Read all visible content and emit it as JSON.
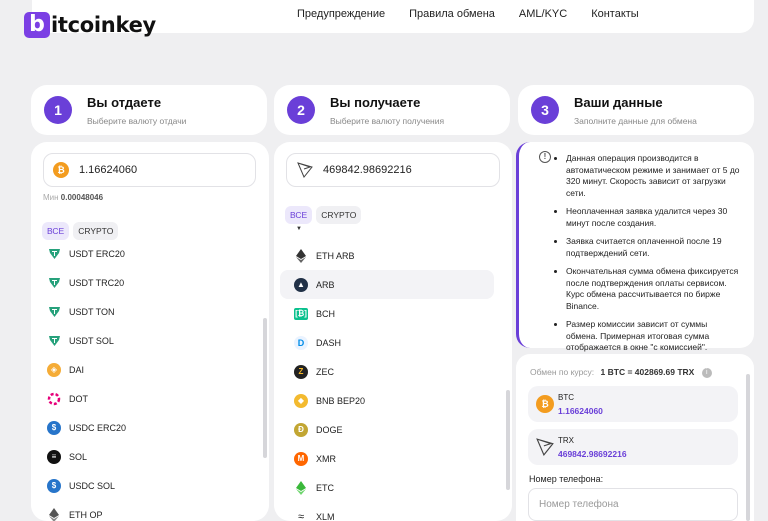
{
  "header": {
    "logo_b": "b",
    "logo_text": "itcoinkey",
    "nav": [
      "Предупреждение",
      "Правила обмена",
      "AML/KYC",
      "Контакты"
    ]
  },
  "steps": [
    {
      "num": "1",
      "title": "Вы отдаете",
      "sub": "Выберите валюту отдачи"
    },
    {
      "num": "2",
      "title": "Вы получаете",
      "sub": "Выберите валюту получения"
    },
    {
      "num": "3",
      "title": "Ваши данные",
      "sub": "Заполните данные для обмена"
    }
  ],
  "give": {
    "amount": "1.16624060",
    "min_label": "Мин",
    "min_value": "0.00048046",
    "filters": [
      "ВСЕ",
      "CRYPTO"
    ],
    "items": [
      {
        "label": "USDT ERC20",
        "icon": "tether-icon"
      },
      {
        "label": "USDT TRC20",
        "icon": "tether-icon"
      },
      {
        "label": "USDT TON",
        "icon": "tether-icon"
      },
      {
        "label": "USDT SOL",
        "icon": "tether-icon"
      },
      {
        "label": "DAI",
        "icon": "dai-icon"
      },
      {
        "label": "DOT",
        "icon": "polkadot-icon"
      },
      {
        "label": "USDC ERC20",
        "icon": "usdc-icon"
      },
      {
        "label": "SOL",
        "icon": "solana-icon"
      },
      {
        "label": "USDC SOL",
        "icon": "usdc-icon"
      },
      {
        "label": "ETH OP",
        "icon": "ethereum-icon"
      }
    ]
  },
  "get": {
    "amount": "469842.98692216",
    "filters": [
      "ВСЕ",
      "CRYPTO"
    ],
    "items": [
      {
        "label": "ETH ARB",
        "icon": "ethereum-icon"
      },
      {
        "label": "ARB",
        "icon": "arbitrum-icon"
      },
      {
        "label": "BCH",
        "icon": "bitcoin-cash-icon"
      },
      {
        "label": "DASH",
        "icon": "dash-icon"
      },
      {
        "label": "ZEC",
        "icon": "zcash-icon"
      },
      {
        "label": "BNB BEP20",
        "icon": "bnb-icon"
      },
      {
        "label": "DOGE",
        "icon": "dogecoin-icon"
      },
      {
        "label": "XMR",
        "icon": "monero-icon"
      },
      {
        "label": "ETC",
        "icon": "ethereum-classic-icon"
      },
      {
        "label": "XLM",
        "icon": "stellar-icon"
      }
    ]
  },
  "info": {
    "notes": [
      "Данная операция производится в автоматическом режиме и занимает от 5 до 320 минут. Скорость зависит от загрузки сети.",
      "Неоплаченная заявка удалится через 30 минут после создания.",
      "Заявка считается оплаченной после 19 подтверждений сети.",
      "Окончательная сумма обмена фиксируется после подтверждения оплаты сервисом. Курс обмена рассчитывается по бирже Binance.",
      "Размер комиссии зависит от суммы обмена. Примерная итоговая сумма отображается в окне \"с комиссией\"."
    ]
  },
  "summary": {
    "rate_label": "Обмен по курсу:",
    "rate_value": "1 BTC = 402869.69 TRX",
    "give_coin": "BTC",
    "give_amount": "1.16624060",
    "get_coin": "TRX",
    "get_amount": "469842.98692216",
    "phone_label": "Номер телефона:",
    "phone_placeholder": "Номер телефона"
  },
  "colors": {
    "accent": "#6a3fd8",
    "btc": "#f39c1f",
    "tether": "#26a17b"
  }
}
